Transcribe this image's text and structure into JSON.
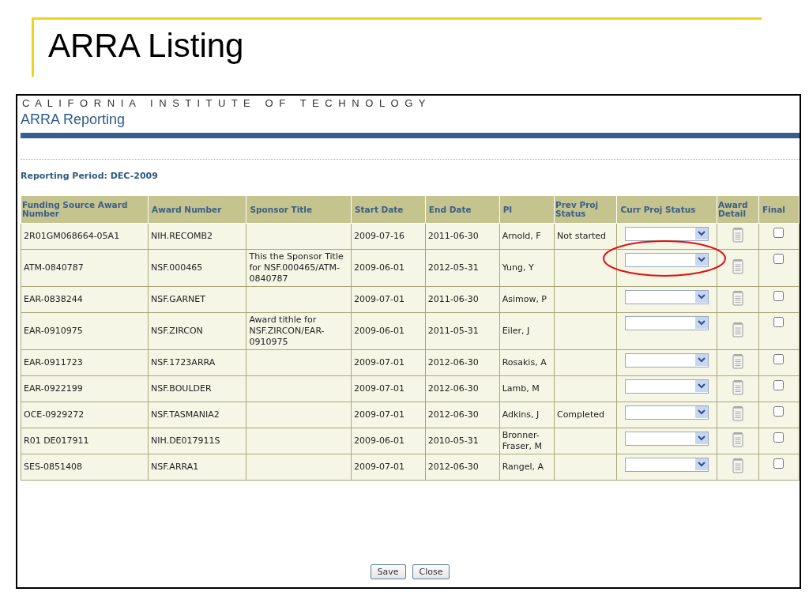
{
  "slide": {
    "title": "ARRA Listing"
  },
  "header": {
    "institution": "C A L I F O R N I A   I N S T I T U T E   O F   T E C H N O L O G Y",
    "app_title": "ARRA Reporting"
  },
  "reporting_period": "Reporting Period:  DEC-2009",
  "table": {
    "columns": [
      "Funding Source Award Number",
      "Award Number",
      "Sponsor Title",
      "Start Date",
      "End Date",
      "PI",
      "Prev Proj Status",
      "Curr Proj Status",
      "Award Detail",
      "Final"
    ],
    "rows": [
      {
        "funding_source": "2R01GM068664-05A1",
        "award_number": "NIH.RECOMB2",
        "sponsor_title": "",
        "start_date": "2009-07-16",
        "end_date": "2011-06-30",
        "pi": "Arnold, F",
        "prev_status": "Not started",
        "final": false,
        "highlighted": false
      },
      {
        "funding_source": "ATM-0840787",
        "award_number": "NSF.000465",
        "sponsor_title": "This the Sponsor Title for NSF.000465/ATM-0840787",
        "start_date": "2009-06-01",
        "end_date": "2012-05-31",
        "pi": "Yung, Y",
        "prev_status": "",
        "final": false,
        "highlighted": true
      },
      {
        "funding_source": "EAR-0838244",
        "award_number": "NSF.GARNET",
        "sponsor_title": "",
        "start_date": "2009-07-01",
        "end_date": "2011-06-30",
        "pi": "Asimow, P",
        "prev_status": "",
        "final": false,
        "highlighted": false
      },
      {
        "funding_source": "EAR-0910975",
        "award_number": "NSF.ZIRCON",
        "sponsor_title": "Award tithle for NSF.ZIRCON/EAR-0910975",
        "start_date": "2009-06-01",
        "end_date": "2011-05-31",
        "pi": "Eiler, J",
        "prev_status": "",
        "final": false,
        "highlighted": false
      },
      {
        "funding_source": "EAR-0911723",
        "award_number": "NSF.1723ARRA",
        "sponsor_title": "",
        "start_date": "2009-07-01",
        "end_date": "2012-06-30",
        "pi": "Rosakis, A",
        "prev_status": "",
        "final": false,
        "highlighted": false
      },
      {
        "funding_source": "EAR-0922199",
        "award_number": "NSF.BOULDER",
        "sponsor_title": "",
        "start_date": "2009-07-01",
        "end_date": "2012-06-30",
        "pi": "Lamb, M",
        "prev_status": "",
        "final": false,
        "highlighted": false
      },
      {
        "funding_source": "OCE-0929272",
        "award_number": "NSF.TASMANIA2",
        "sponsor_title": "",
        "start_date": "2009-07-01",
        "end_date": "2012-06-30",
        "pi": "Adkins, J",
        "prev_status": "Completed",
        "final": false,
        "highlighted": false
      },
      {
        "funding_source": "R01 DE017911",
        "award_number": "NIH.DE017911S",
        "sponsor_title": "",
        "start_date": "2009-06-01",
        "end_date": "2010-05-31",
        "pi": "Bronner-Fraser, M",
        "prev_status": "",
        "final": false,
        "highlighted": false
      },
      {
        "funding_source": "SES-0851408",
        "award_number": "NSF.ARRA1",
        "sponsor_title": "",
        "start_date": "2009-07-01",
        "end_date": "2012-06-30",
        "pi": "Rangel, A",
        "prev_status": "",
        "final": false,
        "highlighted": false
      }
    ]
  },
  "buttons": [
    "Save",
    "Close"
  ]
}
